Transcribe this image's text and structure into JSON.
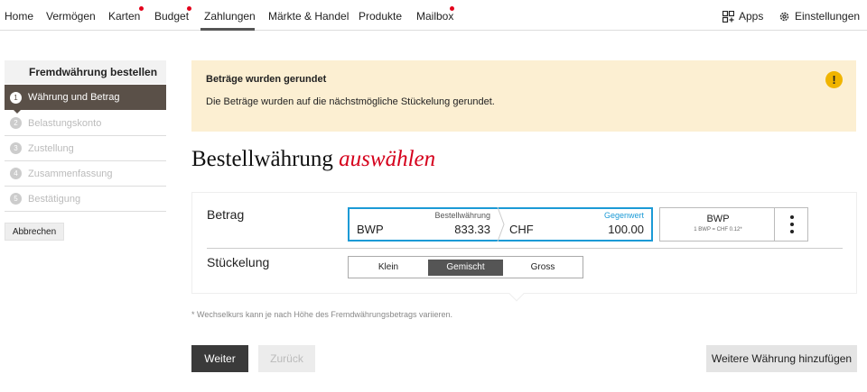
{
  "nav": {
    "items": [
      "Home",
      "Vermögen",
      "Karten",
      "Budget",
      "Zahlungen",
      "Märkte & Handel",
      "Produkte",
      "Mailbox"
    ],
    "active": "Zahlungen",
    "apps_label": "Apps",
    "settings_label": "Einstellungen"
  },
  "sidebar": {
    "title": "Fremdwährung bestellen",
    "steps": [
      {
        "num": "1",
        "label": "Währung und Betrag"
      },
      {
        "num": "2",
        "label": "Belastungskonto"
      },
      {
        "num": "3",
        "label": "Zustellung"
      },
      {
        "num": "4",
        "label": "Zusammenfassung"
      },
      {
        "num": "5",
        "label": "Bestätigung"
      }
    ],
    "cancel_label": "Abbrechen"
  },
  "banner": {
    "title": "Beträge wurden gerundet",
    "text": "Die Beträge wurden auf die nächstmögliche Stückelung gerundet.",
    "icon": "!"
  },
  "heading": {
    "main": "Bestellwährung",
    "accent": "auswählen"
  },
  "form": {
    "amount_label": "Betrag",
    "denomination_label": "Stückelung",
    "order_currency_caption": "Bestellwährung",
    "order_currency": "BWP",
    "order_amount": "833.33",
    "counter_caption": "Gegenwert",
    "counter_currency": "CHF",
    "counter_amount": "100.00",
    "rate_currency": "BWP",
    "rate_text": "1 BWP = CHF 0.12*",
    "denominations": [
      "Klein",
      "Gemischt",
      "Gross"
    ],
    "denomination_selected": "Gemischt"
  },
  "footnote": "* Wechselkurs kann je nach Höhe des Fremdwährungsbetrags variieren.",
  "buttons": {
    "next": "Weiter",
    "back": "Zurück",
    "add_currency": "Weitere Währung hinzufügen"
  },
  "colors": {
    "accent_red": "#d5001c",
    "input_border": "#1b9ad6",
    "banner_bg": "#fcefd2",
    "warning_icon": "#f0b400"
  }
}
